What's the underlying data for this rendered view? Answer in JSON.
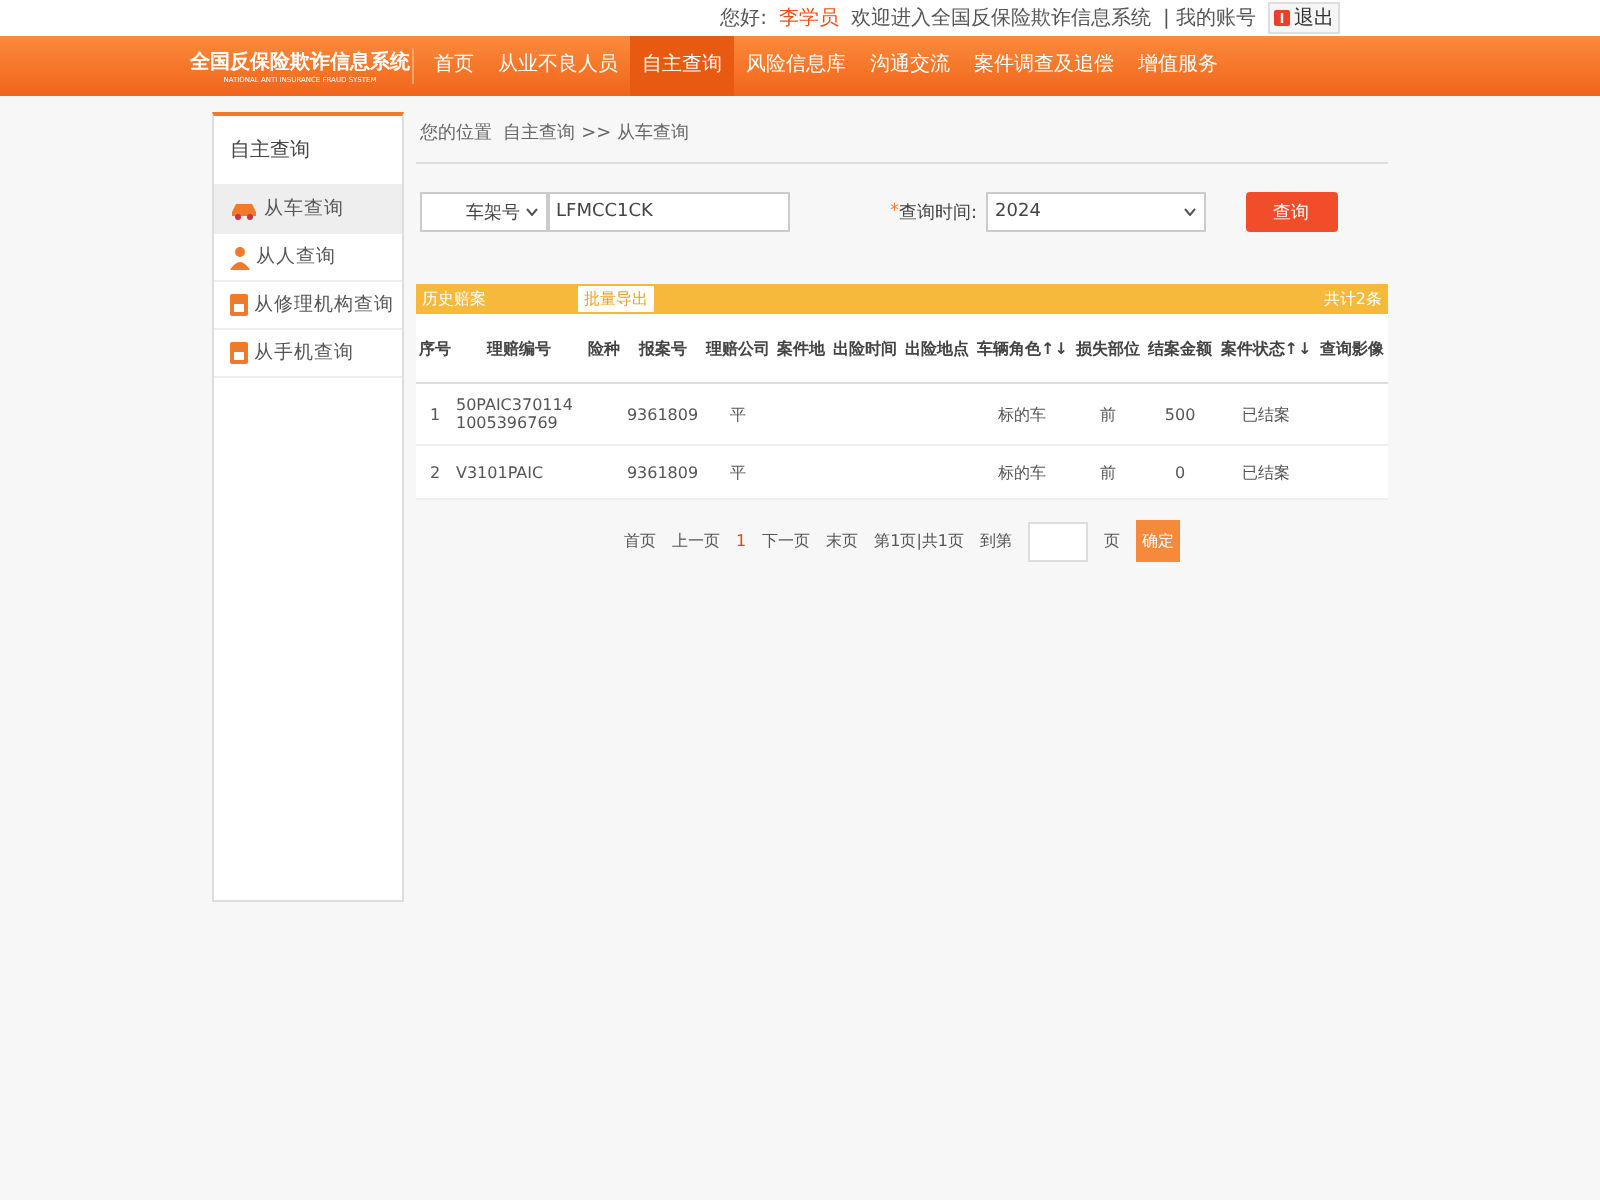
{
  "top_bar": {
    "greeting": "您好:",
    "user": "李学员",
    "welcome": "欢迎进入全国反保险欺诈信息系统",
    "account_link": "| 我的账号",
    "logout": "退出"
  },
  "logo": {
    "title": "全国反保险欺诈信息系统",
    "subtitle": "NATIONAL ANTI INSURANCE FRAUD SYSTEM"
  },
  "nav": [
    {
      "label": "首页",
      "selected": false
    },
    {
      "label": "从业不良人员",
      "selected": false
    },
    {
      "label": "自主查询",
      "selected": true
    },
    {
      "label": "风险信息库",
      "selected": false
    },
    {
      "label": "沟通交流",
      "selected": false
    },
    {
      "label": "案件调查及追偿",
      "selected": false
    },
    {
      "label": "增值服务",
      "selected": false
    }
  ],
  "sidebar": {
    "title": "自主查询",
    "items": [
      {
        "label": "从车查询",
        "kind": "car",
        "selected": true
      },
      {
        "label": "从人查询",
        "kind": "person",
        "selected": false
      },
      {
        "label": "从修理机构查询",
        "kind": "repair",
        "selected": false
      },
      {
        "label": "从手机查询",
        "kind": "phone",
        "selected": false
      }
    ]
  },
  "breadcrumb": "您的位置  自主查询 >> 从车查询",
  "search": {
    "field_type": "车架号",
    "value": "LFMCC1CK",
    "required_mark": "*",
    "time_label": "查询时间:",
    "time_value": "2024",
    "button": "查询"
  },
  "table": {
    "title": "历史赔案",
    "export_button": "批量导出",
    "total": "共计2条",
    "columns": [
      "序号",
      "理赔编号",
      "险种",
      "报案号",
      "理赔公司",
      "案件地",
      "出险时间",
      "出险地点",
      "车辆角色↑↓",
      "损失部位",
      "结案金额",
      "案件状态↑↓",
      "查询影像"
    ],
    "rows": [
      [
        "1",
        "50PAIC3701141005396769",
        "",
        "9361809",
        "平",
        "",
        "",
        "",
        "标的车",
        "前",
        "500",
        "已结案",
        ""
      ],
      [
        "2",
        "V3101PAIC",
        "",
        "9361809",
        "平",
        "",
        "",
        "",
        "标的车",
        "前",
        "0",
        "已结案",
        ""
      ]
    ]
  },
  "pagination": {
    "first": "首页",
    "prev": "上一页",
    "current": "1",
    "next": "下一页",
    "last": "末页",
    "info": "第1页|共1页",
    "goto": "到第",
    "page_unit": "页",
    "confirm": "确定"
  }
}
